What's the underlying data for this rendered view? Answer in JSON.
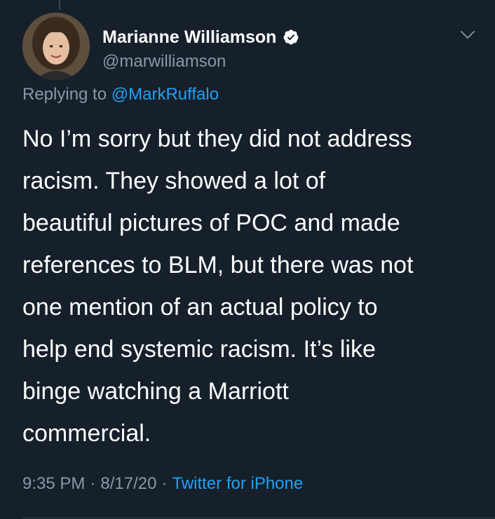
{
  "tweet": {
    "author": {
      "display_name": "Marianne Williamson",
      "handle": "@marwilliamson",
      "verified": true,
      "verified_icon": "verified-badge-icon"
    },
    "reply": {
      "prefix": "Replying to",
      "mention": "@MarkRuffalo"
    },
    "text_lines": [
      "No I’m sorry but they did not address",
      "racism. They showed a lot of",
      "beautiful pictures of POC and made",
      "references to BLM, but there was not",
      "one mention of an actual policy to",
      "help end systemic racism. It’s like",
      "binge watching a Marriott",
      "commercial."
    ],
    "meta": {
      "time": "9:35 PM",
      "date": "8/17/20",
      "separator": "·",
      "source": "Twitter for iPhone"
    },
    "menu_icon": "chevron-down-icon"
  },
  "theme": {
    "background": "#15202b",
    "text_primary": "#ffffff",
    "text_secondary": "#8899a6",
    "accent": "#1da1f2",
    "divider": "#38444d"
  }
}
